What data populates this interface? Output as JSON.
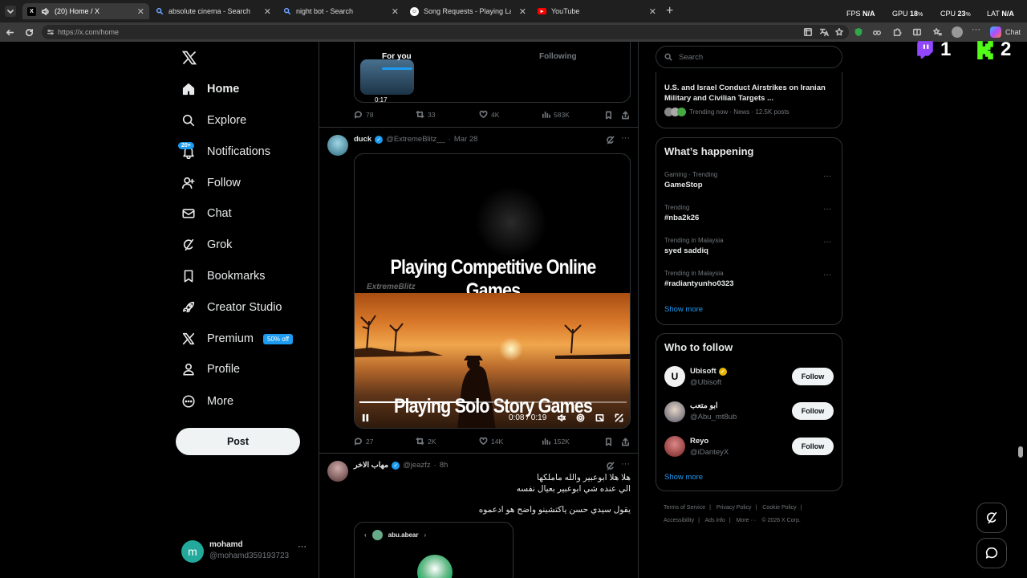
{
  "browser": {
    "tabs": [
      {
        "title": "(20) Home / X",
        "active": true
      },
      {
        "title": "absolute cinema - Search"
      },
      {
        "title": "night bot - Search"
      },
      {
        "title": "Song Requests - Playing Laszlo - S"
      },
      {
        "title": "YouTube"
      }
    ],
    "url": "https://x.com/home",
    "perf": {
      "fps_label": "FPS",
      "fps": "N/A",
      "gpu_label": "GPU",
      "gpu": "18",
      "cpu_label": "CPU",
      "cpu": "23",
      "lat_label": "LAT",
      "lat": "N/A",
      "pct": "%"
    },
    "chat_label": "Chat"
  },
  "overlay": {
    "twitch_count": "1",
    "kick_count": "2"
  },
  "sidebar": {
    "items": [
      {
        "label": "Home",
        "icon": "home-icon"
      },
      {
        "label": "Explore",
        "icon": "search-icon"
      },
      {
        "label": "Notifications",
        "icon": "bell-icon"
      },
      {
        "label": "Follow",
        "icon": "add-user-icon"
      },
      {
        "label": "Chat",
        "icon": "mail-icon"
      },
      {
        "label": "Grok",
        "icon": "grok-icon"
      },
      {
        "label": "Bookmarks",
        "icon": "bookmark-icon"
      },
      {
        "label": "Creator Studio",
        "icon": "rocket-icon"
      },
      {
        "label": "Premium",
        "icon": "x-icon"
      },
      {
        "label": "Profile",
        "icon": "person-icon"
      },
      {
        "label": "More",
        "icon": "more-icon"
      }
    ],
    "notif_badge": "20+",
    "premium_badge": "50% off",
    "post_label": "Post",
    "user": {
      "initial": "m",
      "name": "mohamd",
      "handle": "@mohamd359193723"
    }
  },
  "feed": {
    "tabs": {
      "foryou": "For you",
      "following": "Following"
    },
    "prev": {
      "duration": "0:17",
      "replies": "78",
      "reposts": "33",
      "likes": "4K",
      "views": "583K"
    },
    "tweet1": {
      "name": "duck",
      "handle": "@ExtremeBlitz__",
      "sep": "·",
      "time": "Mar 28",
      "video_top": "Playing Competitive Online Games",
      "video_watermark": "ExtremeBlitz",
      "video_bottom": "Playing Solo Story Games",
      "video_time": "0:08 / 0:19",
      "progress": 0.42,
      "replies": "27",
      "reposts": "2K",
      "likes": "14K",
      "views": "152K"
    },
    "tweet2": {
      "name": "مهاب الاخر",
      "handle": "@jeazfz",
      "sep": "·",
      "time": "8h",
      "line1": "هلا هلا ابوعبير والله ماملكها",
      "line2": "الي عنده شي ابوعبير بعيال نفسه",
      "line3": "يقول سيدي حسن ياكتشينو واضح هو ادعموه",
      "embed_name": "abu.abear",
      "embed_sep": "›"
    }
  },
  "right": {
    "search_placeholder": "Search",
    "news": {
      "headline": "U.S. and Israel Conduct Airstrikes on Iranian Military and Civilian Targets ...",
      "meta": "Trending now · News · 12.5K posts"
    },
    "happening": {
      "title": "What’s happening",
      "trends": [
        {
          "context": "Gaming · Trending",
          "name": "GameStop"
        },
        {
          "context": "Trending",
          "name": "#nba2k26"
        },
        {
          "context": "Trending in Malaysia",
          "name": "syed saddiq"
        },
        {
          "context": "Trending in Malaysia",
          "name": "#radiantyunho0323"
        }
      ],
      "more_glyph": "···",
      "show_more": "Show more"
    },
    "wtf": {
      "title": "Who to follow",
      "people": [
        {
          "name": "Ubisoft",
          "handle": "@Ubisoft",
          "button": "Follow"
        },
        {
          "name": "ابو متعب",
          "handle": "@Abu_mt8ub",
          "button": "Follow"
        },
        {
          "name": "Reyo",
          "handle": "@iDanteyX",
          "button": "Follow"
        }
      ],
      "show_more": "Show more"
    },
    "footer": [
      "Terms of Service",
      "|",
      "Privacy Policy",
      "|",
      "Cookie Policy",
      "|",
      "Accessibility",
      "|",
      "Ads info",
      "|",
      "More ···",
      "© 2026 X Corp."
    ]
  },
  "colors": {
    "accent": "#1d9bf0",
    "bg": "#000000",
    "border": "#2f3336",
    "muted": "#71767b"
  }
}
